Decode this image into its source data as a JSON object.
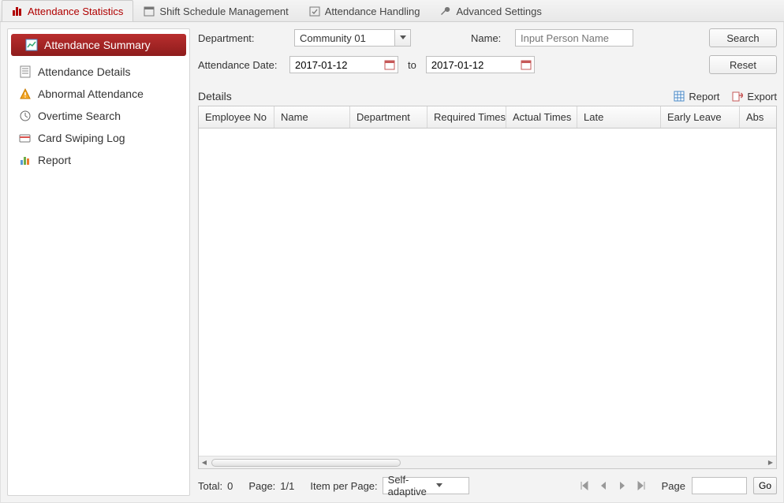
{
  "tabs": {
    "attendance_statistics": "Attendance Statistics",
    "shift_schedule_management": "Shift Schedule Management",
    "attendance_handling": "Attendance Handling",
    "advanced_settings": "Advanced Settings"
  },
  "sidebar": {
    "attendance_summary": "Attendance Summary",
    "attendance_details": "Attendance Details",
    "abnormal_attendance": "Abnormal Attendance",
    "overtime_search": "Overtime Search",
    "card_swiping_log": "Card Swiping Log",
    "report": "Report"
  },
  "filters": {
    "department_label": "Department:",
    "department_value": "Community 01",
    "name_label": "Name:",
    "name_placeholder": "Input Person Name",
    "attendance_date_label": "Attendance Date:",
    "date_from": "2017-01-12",
    "to_label": "to",
    "date_to": "2017-01-12",
    "search_btn": "Search",
    "reset_btn": "Reset"
  },
  "details": {
    "label": "Details",
    "report_btn": "Report",
    "export_btn": "Export"
  },
  "columns": {
    "employee_no": "Employee No",
    "name": "Name",
    "department": "Department",
    "required_times": "Required Times",
    "actual_times": "Actual Times",
    "late": "Late",
    "early_leave": "Early Leave",
    "abs": "Abs"
  },
  "footer": {
    "total_label": "Total:",
    "total_value": "0",
    "page_label": "Page:",
    "page_value": "1/1",
    "items_label": "Item per Page:",
    "items_value": "Self-adaptive",
    "page_word": "Page",
    "go_btn": "Go"
  }
}
